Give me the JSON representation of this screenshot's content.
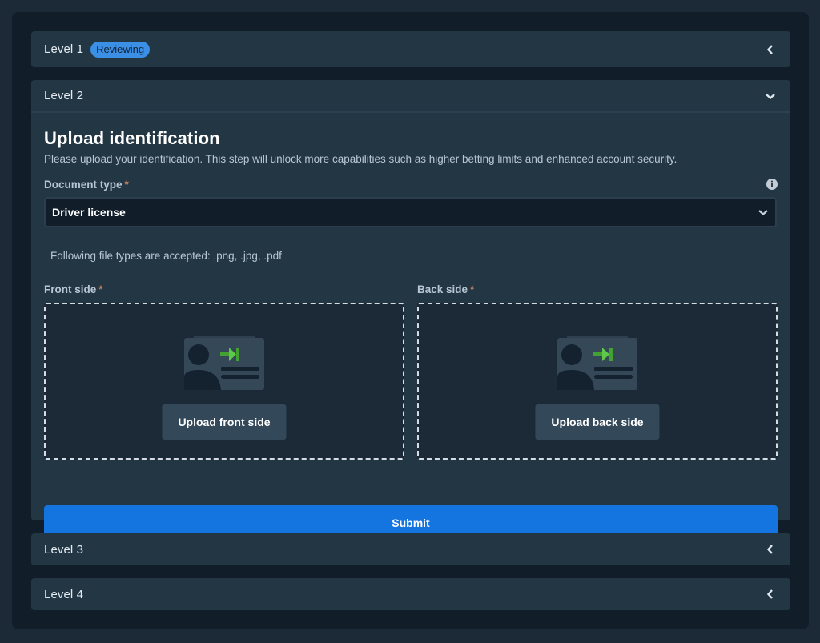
{
  "levels": [
    {
      "title": "Level 1",
      "badge": "Reviewing",
      "state": "collapsed",
      "chevron": "chevron-left-icon"
    },
    {
      "title": "Level 2",
      "state": "expanded",
      "chevron": "chevron-down-icon"
    },
    {
      "title": "Level 3",
      "state": "collapsed",
      "chevron": "chevron-left-icon"
    },
    {
      "title": "Level 4",
      "state": "collapsed",
      "chevron": "chevron-left-icon"
    }
  ],
  "upload": {
    "heading": "Upload identification",
    "description": "Please upload your identification. This step will unlock more capabilities such as higher betting limits and enhanced account security.",
    "document_type": {
      "label": "Document type",
      "required_mark": "*",
      "info_icon": "i",
      "selected": "Driver license"
    },
    "accepted_types": "Following file types are accepted: .png, .jpg, .pdf",
    "front": {
      "label": "Front side",
      "required_mark": "*",
      "button": "Upload front side"
    },
    "back": {
      "label": "Back side",
      "required_mark": "*",
      "button": "Upload back side"
    },
    "submit": "Submit"
  },
  "colors": {
    "badge": "#3b8fe4",
    "submit": "#1575e0",
    "required": "#c27c5e",
    "arrow": "#4cb43a"
  }
}
